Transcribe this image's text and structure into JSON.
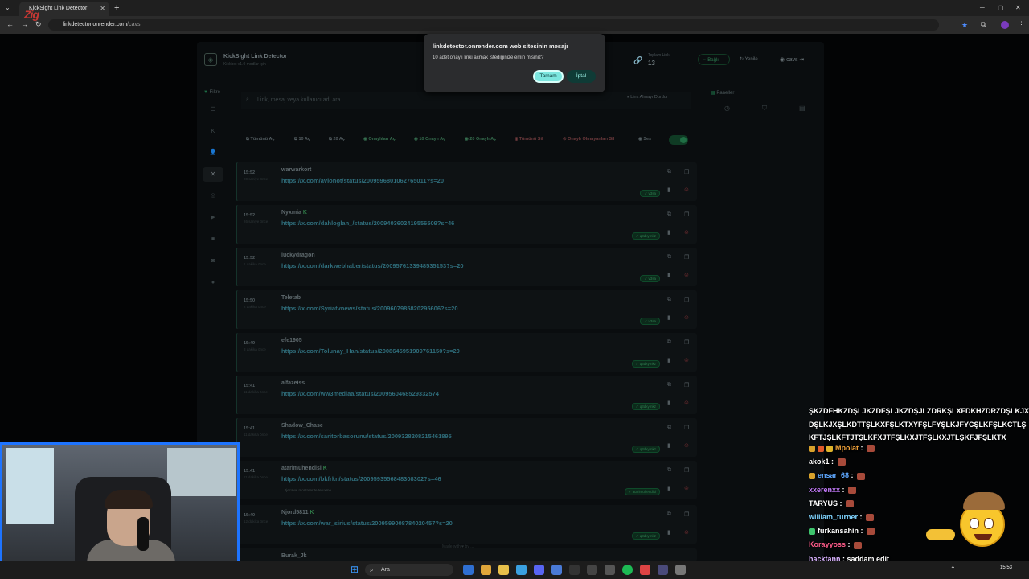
{
  "browser": {
    "tab_title": "KickSight Link Detector",
    "tab_close": "✕",
    "new_tab": "+",
    "url_host": "linkdetector.onrender.com",
    "url_path": "/cavs"
  },
  "app": {
    "title": "KickSight Link Detector",
    "subtitle": "Kickbot v1.0 modlar için",
    "stat_label": "Toplam Link",
    "stat_value": "13",
    "connected_label": "Bağlı",
    "refresh_label": "Yenile",
    "user_name": "cavs",
    "filter_heading": "Filtre",
    "search_placeholder": "Link, mesaj veya kullanıcı adı ara...",
    "stop_button": "Link Almayı Durdur",
    "actions": {
      "open_all": "Tümünü Aç",
      "open_10": "10 Aç",
      "open_20": "20 Aç",
      "open_approved": "Onaylıları Aç",
      "open_10_approved": "10 Onaylı Aç",
      "open_20_approved": "20 Onaylı Aç",
      "delete_all": "Tümünü Sil",
      "delete_unapproved": "Onaylı Olmayanları Sil",
      "sound": "Ses"
    },
    "panel_heading": "Paneller",
    "footer": "Made with ♥ by ..."
  },
  "links": [
    {
      "time": "15:52",
      "ago": "20 saniye önce",
      "user": "warwarkort",
      "kick": false,
      "url": "https://x.com/avionot/status/2009596801062765011?s=20",
      "badge": "v3sa",
      "note": ""
    },
    {
      "time": "15:52",
      "ago": "26 saniye önce",
      "user": "Nyxmia",
      "kick": true,
      "url": "https://x.com/dahloglan_/status/2009403602419556509?s=46",
      "badge": "q3dkymkz",
      "note": ""
    },
    {
      "time": "15:52",
      "ago": "1 dakika önce",
      "user": "luckydragon",
      "kick": false,
      "url": "https://x.com/darkwebhaber/status/2009576133948535153?s=20",
      "badge": "v3sa",
      "note": ""
    },
    {
      "time": "15:50",
      "ago": "2 dakika önce",
      "user": "Teletab",
      "kick": false,
      "url": "https://x.com/Syriatvnews/status/2009607985820295606?s=20",
      "badge": "v3sa",
      "note": ""
    },
    {
      "time": "15:49",
      "ago": "3 dakika önce",
      "user": "efe1905",
      "kick": false,
      "url": "https://x.com/Tolunay_Han/status/2008645951909761150?s=20",
      "badge": "q3dkymkz",
      "note": ""
    },
    {
      "time": "15:41",
      "ago": "11 dakika önce",
      "user": "alfazeiss",
      "kick": false,
      "url": "https://x.com/ww3mediaa/status/2009560468529332574",
      "badge": "q3dkymkz",
      "note": ""
    },
    {
      "time": "15:41",
      "ago": "11 dakika önce",
      "user": "Shadow_Chase",
      "kick": false,
      "url": "https://x.com/saritorbasorunu/status/2009328208215461895",
      "badge": "q3dkymkz",
      "note": ""
    },
    {
      "time": "15:41",
      "ago": "11 dakika önce",
      "user": "atarimuhendisi",
      "kick": true,
      "url": "https://x.com/bkfrkn/status/2009593556848308302?s=46",
      "badge": "atarimuhendisi",
      "note": "tjecawe montreer te teruxme"
    },
    {
      "time": "15:40",
      "ago": "12 dakika önce",
      "user": "Njord5811",
      "kick": true,
      "url": "https://x.com/war_sirius/status/2009599008784020457?s=20",
      "badge": "q3dkymkz",
      "note": ""
    },
    {
      "time": "",
      "ago": "",
      "user": "Burak_Jk",
      "kick": false,
      "url": "",
      "badge": "",
      "note": ""
    }
  ],
  "dialog": {
    "title": "linkdetector.onrender.com web sitesinin mesajı",
    "message": "10 adet onaylı linki açmak istediğinize emin misiniz?",
    "ok": "Tamam",
    "cancel": "İptal"
  },
  "stream": {
    "logo_text": "Zig",
    "chat_spam": "ŞKZDFHKZDŞLJKZDFŞLJKZDŞJLZDRKŞLXFDKHZDRZDŞLKJXDŞLKJXŞLKDTTŞLKXFŞLKTXYFŞLFYŞLKJFYCŞLKFŞLKCTLŞKFTJŞLKFTJTŞLKFXJTFŞLKXJTFŞLKXJTLŞKFJFŞLKTX",
    "chat": [
      {
        "user": "Mpolat",
        "color": "#f2a33a",
        "msg": ""
      },
      {
        "user": "akok1",
        "color": "#ffffff",
        "msg": ""
      },
      {
        "user": "ensar_68",
        "color": "#5ea8ff",
        "msg": ""
      },
      {
        "user": "xxerenxx",
        "color": "#c77dff",
        "msg": ""
      },
      {
        "user": "TARYUS",
        "color": "#ffffff",
        "msg": ""
      },
      {
        "user": "william_turner",
        "color": "#7fd4ff",
        "msg": ""
      },
      {
        "user": "furkansahin",
        "color": "#ffffff",
        "msg": ""
      },
      {
        "user": "Korayyoss",
        "color": "#ff5c8a",
        "msg": ""
      },
      {
        "user": "hacktann",
        "color": "#d9b3ff",
        "msg": "saddam edit"
      }
    ]
  },
  "taskbar": {
    "search": "Ara",
    "clock": "15:53"
  }
}
